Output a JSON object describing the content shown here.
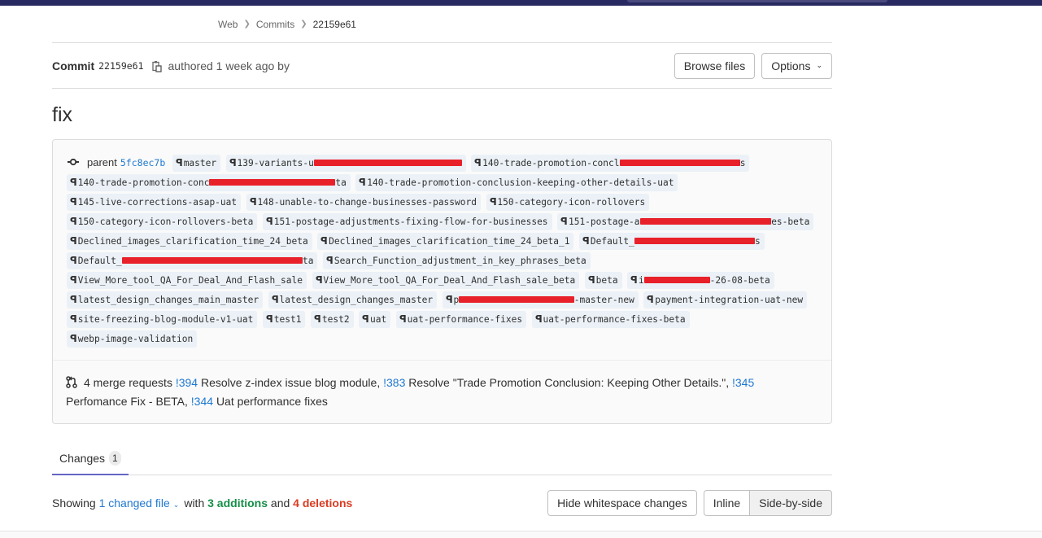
{
  "breadcrumb": [
    {
      "label": "Web"
    },
    {
      "label": "Commits"
    },
    {
      "label": "22159e61"
    }
  ],
  "header": {
    "commit_label": "Commit",
    "sha": "22159e61",
    "authored": "authored 1 week ago by",
    "browse_files": "Browse files",
    "options": "Options"
  },
  "title": "fix",
  "refs": {
    "parent_label": "parent",
    "parent_sha": "5fc8ec7b",
    "branches": [
      {
        "name": "master",
        "redacted": false
      },
      {
        "name": "139-variants-u███████████████████████████",
        "redacted": true
      },
      {
        "name": "140-trade-promotion-concl██████████████████████s",
        "redacted": true
      },
      {
        "name": "140-trade-promotion-conc███████████████████████ta",
        "redacted": true
      },
      {
        "name": "140-trade-promotion-conclusion-keeping-other-details-uat",
        "redacted": false
      },
      {
        "name": "145-live-corrections-asap-uat",
        "redacted": false
      },
      {
        "name": "148-unable-to-change-businesses-password",
        "redacted": false
      },
      {
        "name": "150-category-icon-rollovers",
        "redacted": false
      },
      {
        "name": "150-category-icon-rollovers-beta",
        "redacted": false
      },
      {
        "name": "151-postage-adjustments-fixing-flow-for-businesses",
        "redacted": false
      },
      {
        "name": "151-postage-a████████████████████████es-beta",
        "redacted": true
      },
      {
        "name": "Declined_images_clarification_time_24_beta",
        "redacted": false
      },
      {
        "name": "Declined_images_clarification_time_24_beta_1",
        "redacted": false
      },
      {
        "name": "Default_██████████████████████s",
        "redacted": true
      },
      {
        "name": "Default_█████████████████████████████████ta",
        "redacted": true
      },
      {
        "name": "Search_Function_adjustment_in_key_phrases_beta",
        "redacted": false
      },
      {
        "name": "View_More_tool_QA_For_Deal_And_Flash_sale",
        "redacted": false
      },
      {
        "name": "View_More_tool_QA_For_Deal_And_Flash_sale_beta",
        "redacted": false
      },
      {
        "name": "beta",
        "redacted": false
      },
      {
        "name": "i████████████-26-08-beta",
        "redacted": true
      },
      {
        "name": "latest_design_changes_main_master",
        "redacted": false
      },
      {
        "name": "latest_design_changes_master",
        "redacted": false
      },
      {
        "name": "p█████████████████████-master-new",
        "redacted": true
      },
      {
        "name": "payment-integration-uat-new",
        "redacted": false
      },
      {
        "name": "site-freezing-blog-module-v1-uat",
        "redacted": false
      },
      {
        "name": "test1",
        "redacted": false
      },
      {
        "name": "test2",
        "redacted": false
      },
      {
        "name": "uat",
        "redacted": false
      },
      {
        "name": "uat-performance-fixes",
        "redacted": false
      },
      {
        "name": "uat-performance-fixes-beta",
        "redacted": false
      },
      {
        "name": "webp-image-validation",
        "redacted": false
      }
    ]
  },
  "merge_requests": {
    "count_text": "4 merge requests",
    "items": [
      {
        "ref": "!394",
        "title": "Resolve z-index issue blog module",
        "sep": ", "
      },
      {
        "ref": "!383",
        "title": "Resolve \"Trade Promotion Conclusion: Keeping Other Details.\"",
        "sep": ", "
      },
      {
        "ref": "!345",
        "title": "Perfomance Fix - BETA",
        "sep": ", "
      },
      {
        "ref": "!344",
        "title": "Uat performance fixes",
        "sep": ""
      }
    ]
  },
  "tabs": [
    {
      "label": "Changes",
      "count": "1",
      "active": true
    }
  ],
  "diff_summary": {
    "showing": "Showing",
    "changed_files": "1 changed file",
    "with": "with",
    "additions": "3 additions",
    "and": "and",
    "deletions": "4 deletions",
    "colors": {
      "additions": "#168f48",
      "deletions": "#db3b21",
      "link": "#1f78d1"
    }
  },
  "diff_controls": {
    "hide_whitespace": "Hide whitespace changes",
    "inline": "Inline",
    "side_by_side": "Side-by-side",
    "selected_view": "Side-by-side"
  },
  "theme": {
    "navbar": "#292961",
    "tab_active": "#6666c4"
  }
}
